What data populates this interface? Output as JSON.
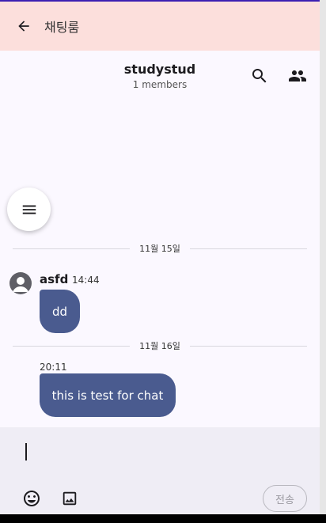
{
  "appbar": {
    "title": "채팅룸"
  },
  "room": {
    "name": "studystud",
    "members": "1 members"
  },
  "dates": [
    "11월 15일",
    "11월 16일"
  ],
  "messages": [
    {
      "sender": "asfd",
      "time": "14:44",
      "text": "dd"
    },
    {
      "time": "20:11",
      "text": "this is test for chat"
    }
  ],
  "input": {
    "send_label": "전송"
  },
  "colors": {
    "appbar": "#fcdfdc",
    "bubble": "#4a5b8f",
    "chat_bg": "#fbf8ff",
    "input_bg": "#efedf5"
  },
  "icons": [
    "back-arrow-icon",
    "search-icon",
    "people-icon",
    "menu-icon",
    "avatar-icon",
    "emoji-icon",
    "image-icon"
  ]
}
